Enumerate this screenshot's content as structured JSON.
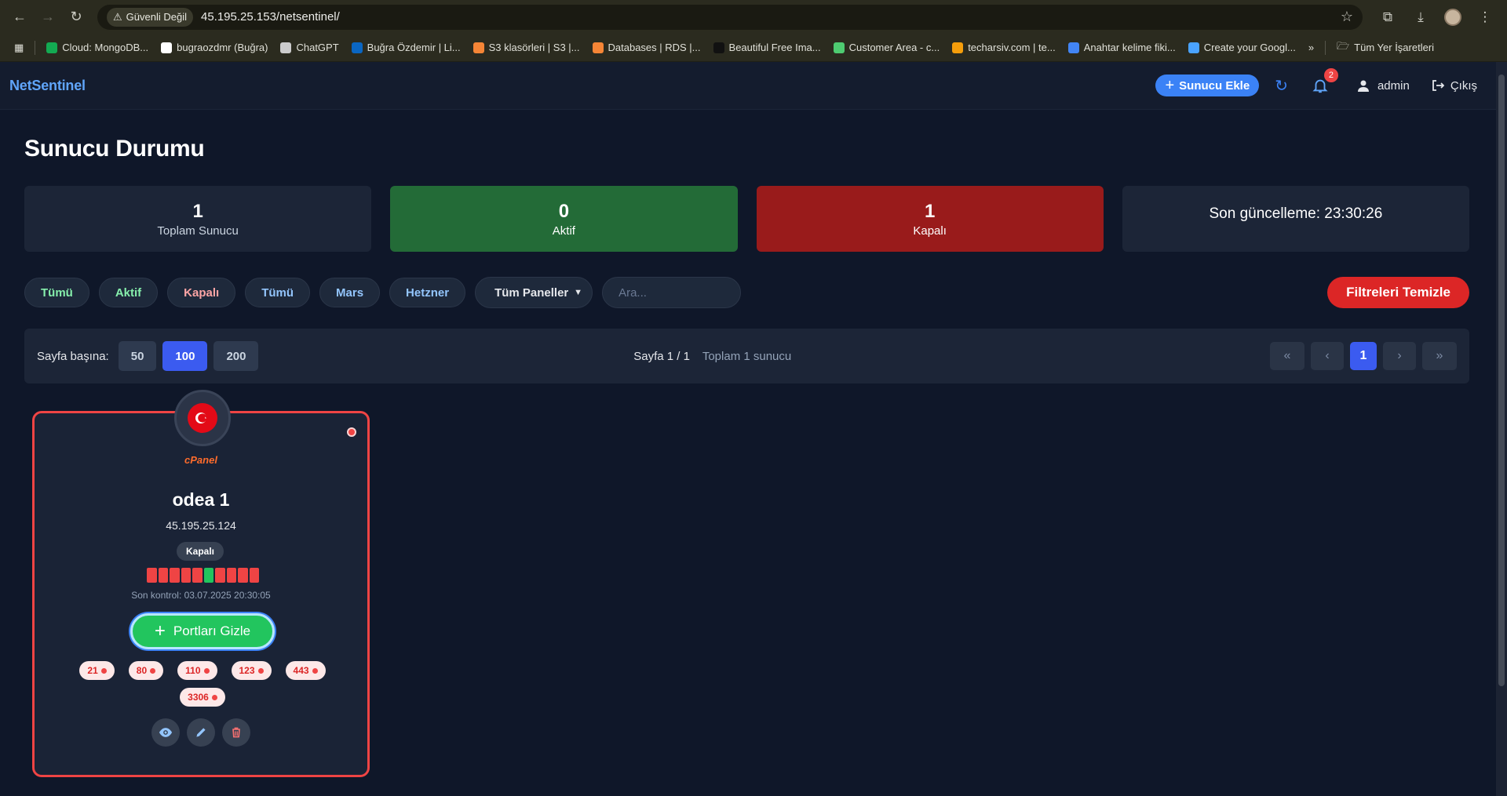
{
  "browser": {
    "security_label": "Güvenli Değil",
    "url": "45.195.25.153/netsentinel/",
    "bookmarks": [
      {
        "label": "Cloud: MongoDB...",
        "color": "#13aa52"
      },
      {
        "label": "bugraozdmr (Buğra)",
        "color": "#ffffff"
      },
      {
        "label": "ChatGPT",
        "color": "#cccccc"
      },
      {
        "label": "Buğra Özdemir | Li...",
        "color": "#0a66c2"
      },
      {
        "label": "S3 klasörleri | S3 |...",
        "color": "#f58536"
      },
      {
        "label": "Databases | RDS |...",
        "color": "#f58536"
      },
      {
        "label": "Beautiful Free Ima...",
        "color": "#111111"
      },
      {
        "label": "Customer Area - c...",
        "color": "#4ecb71"
      },
      {
        "label": "techarsiv.com | te...",
        "color": "#f59e0b"
      },
      {
        "label": "Anahtar kelime fiki...",
        "color": "#4285f4"
      },
      {
        "label": "Create your Googl...",
        "color": "#4aa3ff"
      }
    ],
    "all_bookmarks_label": "Tüm Yer İşaretleri"
  },
  "topbar": {
    "brand": "NetSentinel",
    "add_server_label": "Sunucu Ekle",
    "notification_count": "2",
    "username": "admin",
    "logout_label": "Çıkış"
  },
  "page": {
    "title": "Sunucu Durumu"
  },
  "stats": {
    "total": {
      "value": "1",
      "label": "Toplam Sunucu"
    },
    "active": {
      "value": "0",
      "label": "Aktif"
    },
    "down": {
      "value": "1",
      "label": "Kapalı"
    },
    "updated": "Son güncelleme: 23:30:26"
  },
  "filters": {
    "status_all": "Tümü",
    "status_active": "Aktif",
    "status_down": "Kapalı",
    "provider_all": "Tümü",
    "provider_mars": "Mars",
    "provider_hetzner": "Hetzner",
    "panel_select": "Tüm Paneller",
    "search_placeholder": "Ara...",
    "clear_label": "Filtreleri Temizle"
  },
  "pagination": {
    "per_page_label": "Sayfa başına:",
    "per_page_options": [
      "50",
      "100",
      "200"
    ],
    "per_page_selected": "100",
    "page_info": "Sayfa 1 / 1",
    "total_info": "Toplam 1 sunucu",
    "current_page": "1"
  },
  "server": {
    "panel": "cPanel",
    "name": "odea 1",
    "ip": "45.195.25.124",
    "status": "Kapalı",
    "history": [
      "down",
      "down",
      "down",
      "down",
      "down",
      "up",
      "down",
      "down",
      "down",
      "down"
    ],
    "last_check": "Son kontrol: 03.07.2025 20:30:05",
    "toggle_ports_label": "Portları Gizle",
    "ports": [
      "21",
      "80",
      "110",
      "123",
      "443",
      "3306"
    ]
  },
  "colors": {
    "accent": "#3b82f6",
    "success": "#22c55e",
    "danger": "#ef4444"
  }
}
